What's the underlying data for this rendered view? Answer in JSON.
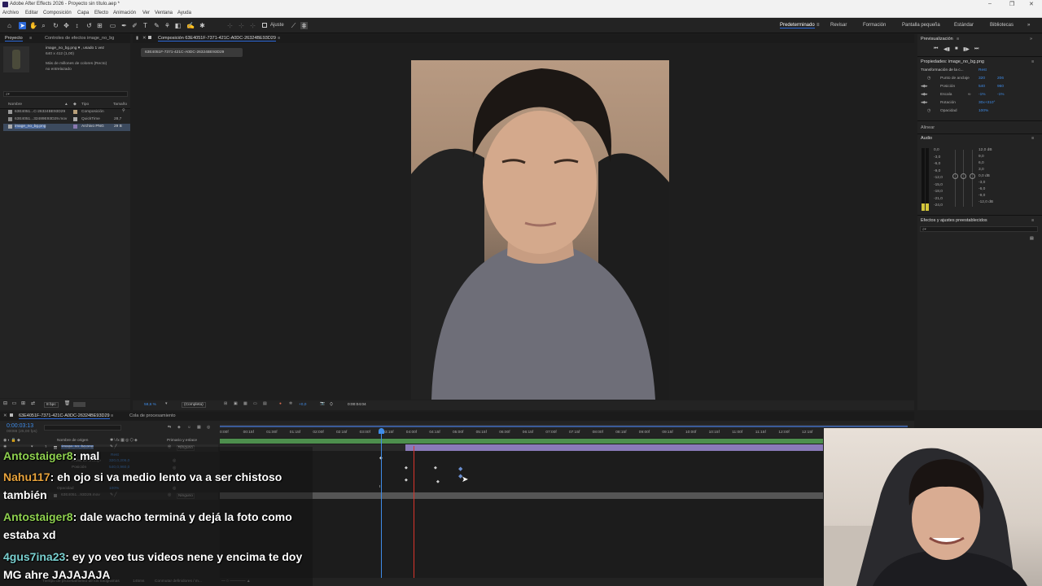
{
  "app": {
    "title": "Adobe After Effects 2026 - Proyecto sin título.aep *",
    "window_controls": [
      "–",
      "❐",
      "✕"
    ]
  },
  "menu": [
    "Archivo",
    "Editar",
    "Composición",
    "Capa",
    "Efecto",
    "Animación",
    "Ver",
    "Ventana",
    "Ayuda"
  ],
  "toolbar": {
    "snap_label": "Ajuste",
    "workspaces": [
      "Predeterminado",
      "Revisar",
      "Formación",
      "Pantalla pequeña",
      "Estándar",
      "Bibliotecas"
    ],
    "active_workspace": "Predeterminado"
  },
  "project": {
    "tab": "Proyecto",
    "effects_tab": "Controles de efectos image_no_bg",
    "asset_name": "image_no_bg.png ▾ , usado 1 vez",
    "asset_size": "640 x 412 (1,00)",
    "asset_color": "Más de millones de colores (Recto)",
    "asset_interp": "no entrelazado",
    "search_placeholder": "⌕▾",
    "columns": [
      "Nombre",
      "Tipo",
      "Tamaño"
    ],
    "items": [
      {
        "name": "63E4051...C-26324BE93D29",
        "type": "Composición",
        "size": ""
      },
      {
        "name": "63E4051...32489E93D29.mov",
        "type": "QuickTime",
        "size": "28,7"
      },
      {
        "name": "image_no_bg.png",
        "type": "Archivo PNG",
        "size": "29 B"
      }
    ],
    "bpc": "8 bpc"
  },
  "composition": {
    "tab": "Composición 63E4051F-7371-421C-A0DC-26324BE93D29",
    "sub_tab": "63E4051F-7371-421C-A0DC-26324BE93D29",
    "zoom": "58,6 %",
    "quality": "(Completa)",
    "exposure": "+0,0",
    "timecode": "0:00:04:04"
  },
  "right_panel": {
    "preview_title": "Previsualización",
    "props_title": "Propiedades: image_no_bg.png",
    "transform": "Transformación de la c...",
    "reset": "Rest",
    "properties": [
      {
        "name": "Punto de anclaje",
        "v1": "320",
        "v2": "206"
      },
      {
        "name": "Posición",
        "v1": "540",
        "v2": "960"
      },
      {
        "name": "Escala",
        "v1": "-1%",
        "v2": "-1%"
      },
      {
        "name": "Rotación",
        "v1": "30x+310°",
        "v2": ""
      },
      {
        "name": "Opacidad",
        "v1": "100%",
        "v2": ""
      }
    ],
    "align": "Alinear",
    "audio": "Audio",
    "audio_left": [
      "0,0",
      "-3,0",
      "-6,0",
      "-9,0",
      "-12,0",
      "-15,0",
      "-18,0",
      "-21,0",
      "-24,0"
    ],
    "audio_right": [
      "12,0 dB",
      "9,0",
      "6,0",
      "3,0",
      "0,0 dB",
      "-3,0",
      "-6,0",
      "-9,0",
      "-12,0 dB"
    ],
    "effects_presets": "Efectos y ajustes preestablecidos",
    "effects_search": "⌕▾"
  },
  "timeline": {
    "tab": "63E4051F-7371-421C-A0DC-26324BE93D29",
    "render_queue": "Cola de procesamiento",
    "current_time": "0:00:03:13",
    "fps": "00088 (25,00 fps)",
    "col_name": "Nombre de origen",
    "col_parent": "Primario y enlace",
    "layer_name": "image_no_bg.png",
    "layer_mode": "Ninguno",
    "layer2_name": "63E4051...93D29.mov",
    "layer2_mode": "Ninguno",
    "sub_props": [
      {
        "name": "Punto de anclaje",
        "value": "320,0,206,0"
      },
      {
        "name": "Posición",
        "value": "540,0,960,0"
      },
      {
        "name": "Opacidad",
        "value": "100%"
      }
    ],
    "reset": "Rest",
    "ruler": [
      "0:00f",
      "00:15f",
      "01:00f",
      "01:15f",
      "02:00f",
      "02:15f",
      "03:00f",
      "03:15f",
      "04:00f",
      "04:15f",
      "05:00f",
      "05:15f",
      "06:00f",
      "06:15f",
      "07:00f",
      "07:15f",
      "08:00f",
      "08:15f",
      "09:00f",
      "09:15f",
      "10:00f",
      "10:15f",
      "11:00f",
      "11:15f",
      "12:00f",
      "12:15f"
    ],
    "status": "Tiempo de procesamiento de los fotogramas",
    "status_ms": "145ms",
    "toggle": "Conmutar definidores / m..."
  },
  "chat": [
    {
      "user": "Antostaiger8",
      "color": "#8fd14f",
      "text": ": mal"
    },
    {
      "user": "Nahu117",
      "color": "#e8a33c",
      "text": ": eh ojo si va medio lento va a ser chistoso"
    },
    {
      "user": "",
      "color": "#ffffff",
      "text": "también"
    },
    {
      "user": "Antostaiger8",
      "color": "#8fd14f",
      "text": ": dale wacho terminá y dejá la foto como"
    },
    {
      "user": "",
      "color": "#ffffff",
      "text": "estaba xd"
    },
    {
      "user": "4gus7ina23",
      "color": "#79d0d0",
      "text": ": ey yo veo tus videos nene y encima te doy"
    },
    {
      "user": "",
      "color": "#ffffff",
      "text": "MG ahre JAJAJAJA"
    }
  ],
  "colors": {
    "accent": "#2d6ad9",
    "playhead": "#3f8ce8",
    "work_marker": "#d9342b",
    "layer_bar": "#4d8f4d",
    "track_bar": "#8a7ab8"
  }
}
